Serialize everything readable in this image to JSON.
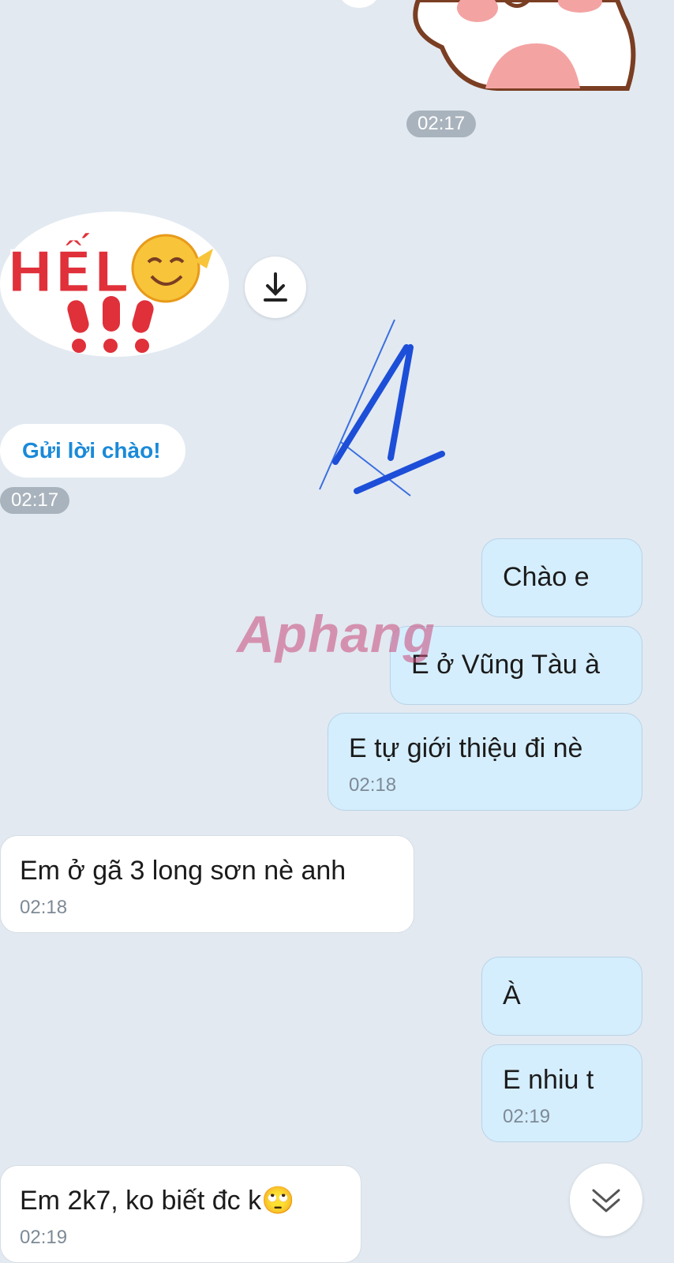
{
  "timestamps": {
    "top": "02:17",
    "greeting": "02:17"
  },
  "sticker": {
    "text": "HẾL"
  },
  "greeting_button": {
    "label": "Gửi lời chào!"
  },
  "watermark": {
    "text": "Aphang"
  },
  "messages": [
    {
      "side": "me",
      "text": "Chào e",
      "time": ""
    },
    {
      "side": "me",
      "text": "E ở Vũng Tàu à",
      "time": ""
    },
    {
      "side": "me",
      "text": "E tự giới thiệu đi nè",
      "time": "02:18"
    },
    {
      "side": "them",
      "text": "Em ở gã 3 long sơn nè anh",
      "time": "02:18"
    },
    {
      "side": "me",
      "text": "À",
      "time": ""
    },
    {
      "side": "me",
      "text": "E nhiu t",
      "time": "02:19"
    },
    {
      "side": "them",
      "text": "Em 2k7, ko biết đc k🙄",
      "time": "02:19"
    }
  ],
  "icons": {
    "download": "download-icon",
    "scroll": "double-chevron-down-icon"
  },
  "colors": {
    "background": "#e2e9f1",
    "my_bubble": "#d5eefd",
    "their_bubble": "#ffffff",
    "link_blue": "#1a8ad8",
    "scribble_blue": "#1d4ed8"
  }
}
